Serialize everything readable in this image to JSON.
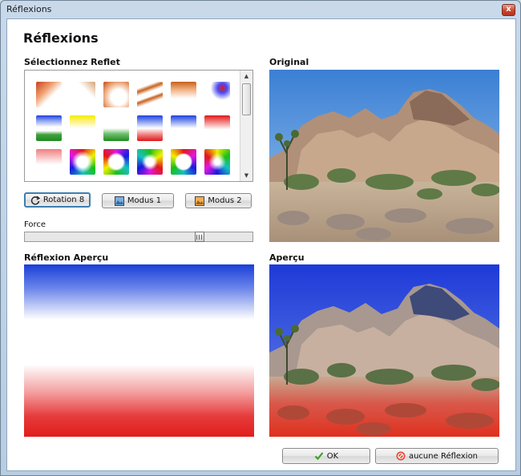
{
  "window": {
    "title": "Réflexions",
    "close_glyph": "x"
  },
  "dialog": {
    "heading": "Réflexions"
  },
  "labels": {
    "select": "Sélectionnez Reflet",
    "original": "Original",
    "force": "Force",
    "reflection_preview": "Réflexion Aperçu",
    "preview": "Aperçu"
  },
  "buttons": {
    "rotation": "Rotation 8",
    "mode1": "Modus 1",
    "mode2": "Modus 2",
    "ok": "OK",
    "none": "aucune Réflexion"
  },
  "slider": {
    "value": 0.78
  },
  "icons": [
    "rotate-icon",
    "landscape-icon",
    "landscape-icon",
    "check-icon",
    "no-icon"
  ]
}
